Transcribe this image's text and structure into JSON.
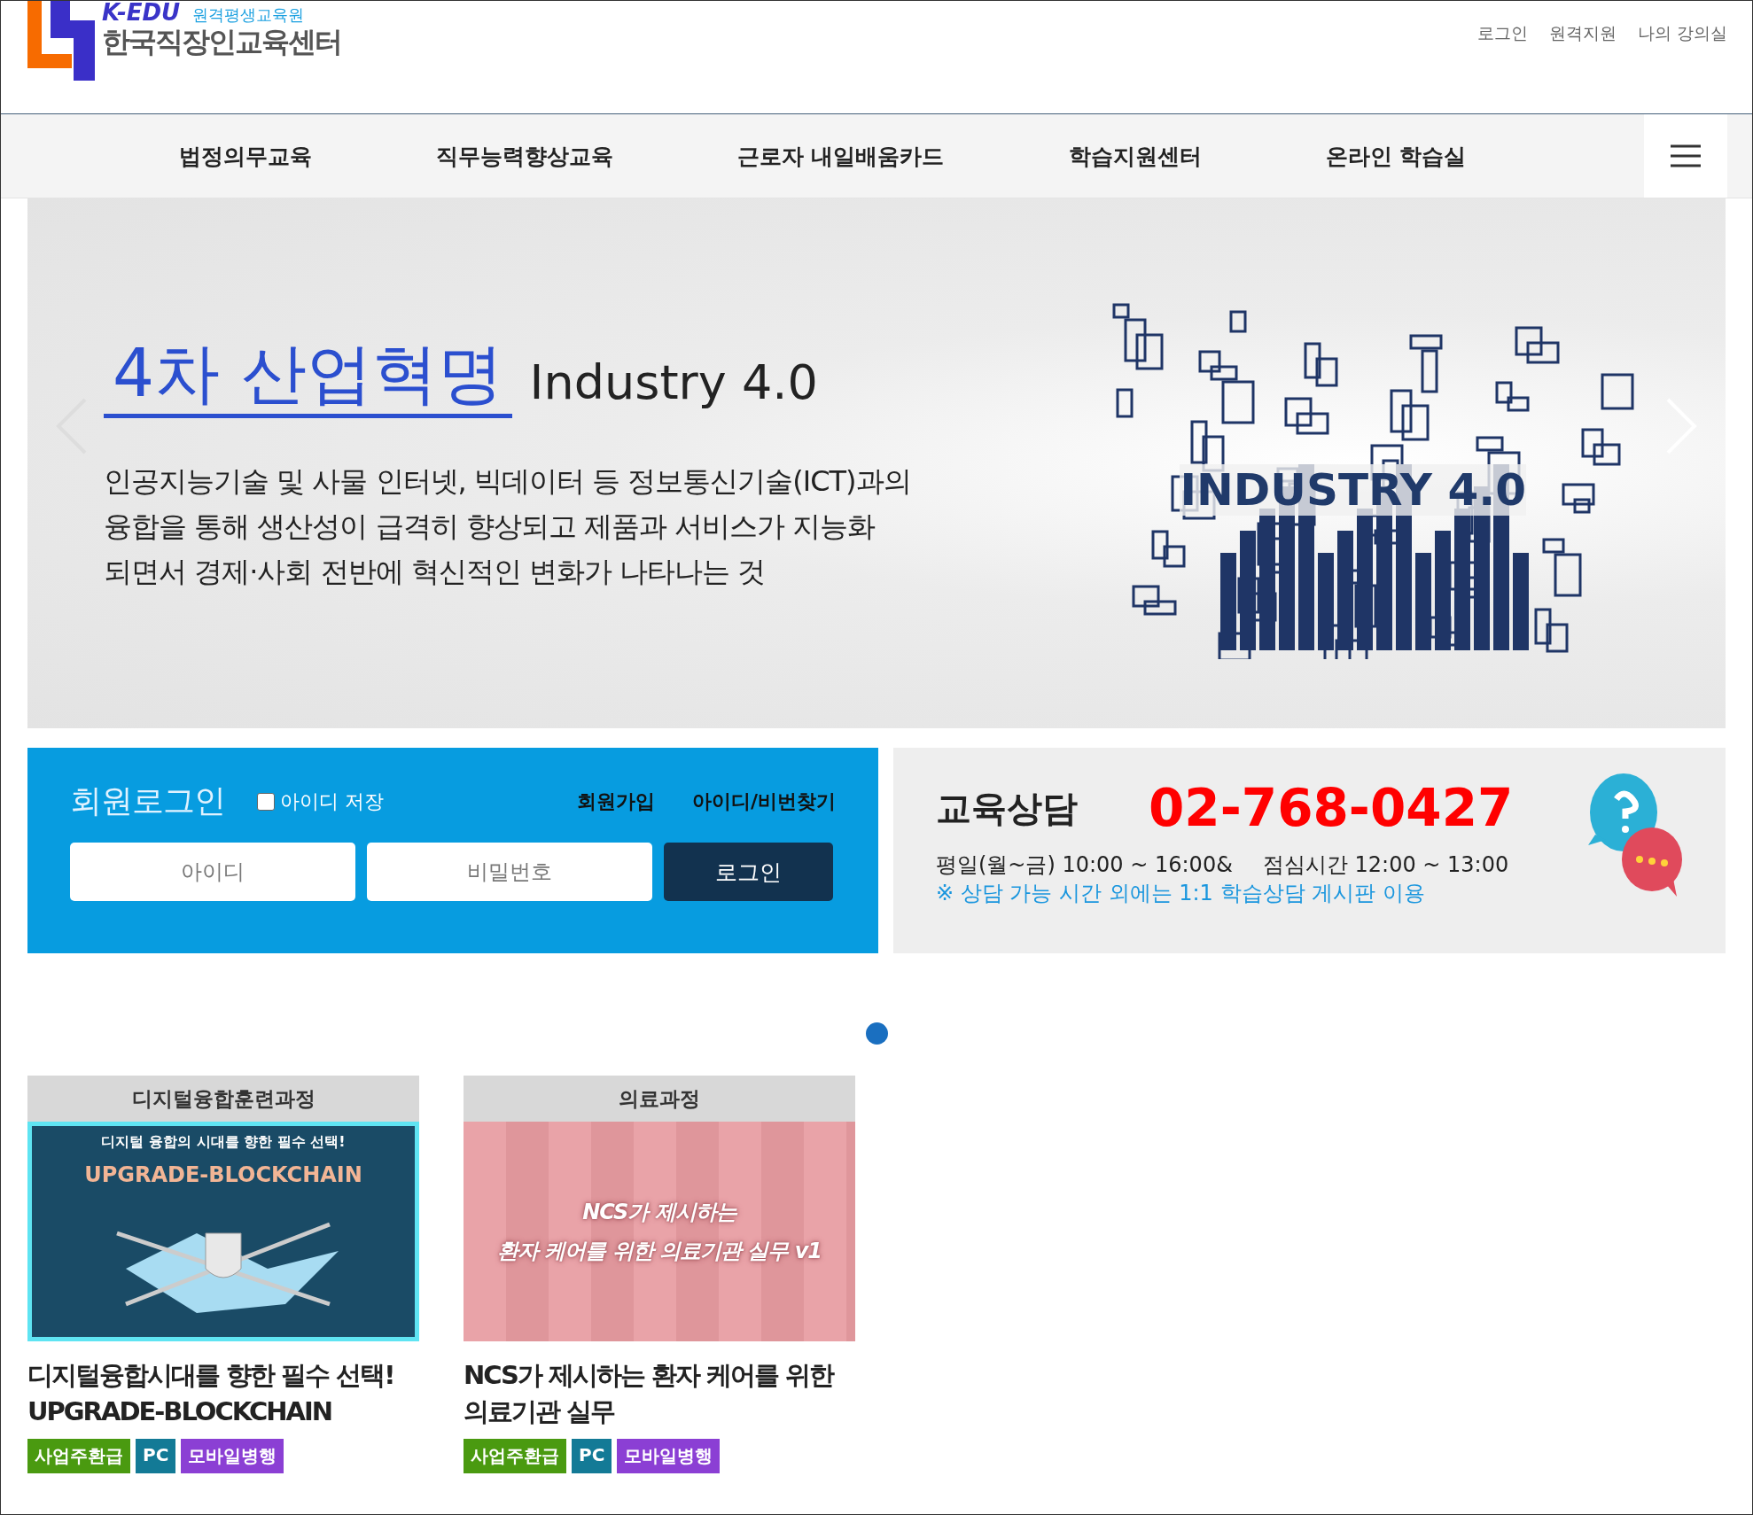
{
  "header": {
    "logo": {
      "brand": "K-EDU",
      "subtitle": "원격평생교육원",
      "name": "한국직장인교육센터"
    },
    "top_links": [
      "로그인",
      "원격지원",
      "나의 강의실"
    ]
  },
  "nav": {
    "items": [
      {
        "label": "법정의무교육"
      },
      {
        "label": "직무능력향상교육"
      },
      {
        "label": "근로자 내일배움카드"
      },
      {
        "label": "학습지원센터"
      },
      {
        "label": "온라인 학습실"
      }
    ]
  },
  "banner": {
    "title": "4차 산업혁명",
    "title_en": "Industry 4.0",
    "description": [
      "인공지능기술 및 사물 인터넷, 빅데이터 등 정보통신기술(ICT)과의",
      "융합을 통해 생산성이 급격히 향상되고 제품과 서비스가 지능화",
      "되면서 경제·사회 전반에 혁신적인 변화가 나타나는 것"
    ],
    "illustration_label": "INDUSTRY 4.0"
  },
  "login": {
    "title": "회원로그인",
    "remember": {
      "label": "아이디 저장",
      "checked": false
    },
    "links": [
      "회원가입",
      "아이디/비번찾기"
    ],
    "id_field": {
      "placeholder": "아이디"
    },
    "password_field": {
      "placeholder": "비밀번호"
    },
    "submit": "로그인"
  },
  "consult": {
    "title": "교육상담",
    "phone": "02-768-0427",
    "hours": "평일(월~금) 10:00 ~ 16:00&",
    "lunch": "점심시간 12:00 ~ 13:00",
    "note": "※ 상담 가능 시간 외에는 1:1 학습상담 게시판 이용"
  },
  "slider_dots": [
    {
      "selected": true
    }
  ],
  "courses": [
    {
      "category": "디지털융합훈련과정",
      "kind": "blockchain",
      "thumb_lines": [
        "디지털 융합의 시대를 향한 필수 선택!",
        "UPGRADE-BLOCKCHAIN"
      ],
      "title": "디지털융합시대를 향한 필수 선택! UPGRADE-BLOCKCHAIN",
      "tags": [
        {
          "label": "사업주환급",
          "color": "#4a9a10"
        },
        {
          "label": "PC",
          "color": "#137a96"
        },
        {
          "label": "모바일병행",
          "color": "#8b3fd4"
        }
      ]
    },
    {
      "category": "의료과정",
      "kind": "medical",
      "thumb_lines": [
        "NCS가 제시하는",
        "환자 케어를 위한 의료기관 실무 v1"
      ],
      "title": "NCS가 제시하는 환자 케어를 위한 의료기관 실무",
      "tags": [
        {
          "label": "사업주환급",
          "color": "#4a9a10"
        },
        {
          "label": "PC",
          "color": "#137a96"
        },
        {
          "label": "모바일병행",
          "color": "#8b3fd4"
        }
      ]
    }
  ]
}
